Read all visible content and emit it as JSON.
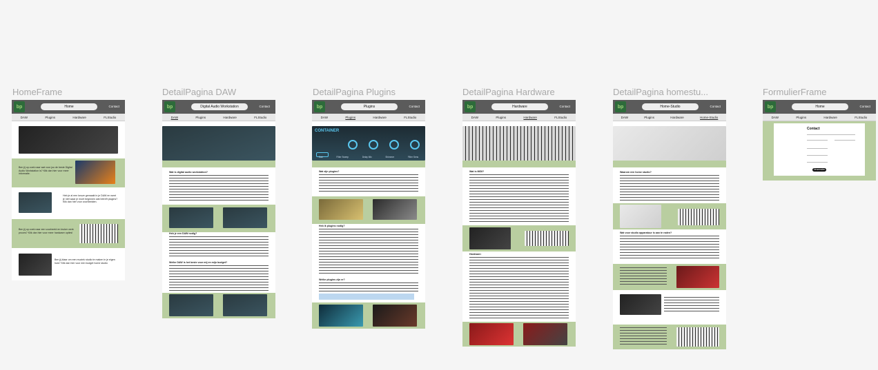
{
  "frames": [
    {
      "label": "HomeFrame",
      "pill": "Home",
      "contact": "Contact",
      "nav": [
        "DAW",
        "Plugins",
        "Hardware",
        "FLStudio"
      ],
      "texts": [
        "Ben jij op zoek naar wat voor jou de beste Digital Audio Workstation is? Klik dan hier voor meer informatie.",
        "Heb je al een keuze gemaakt in je DAW en weet je niet waar je moet beginnen wat betreft plugins? Klik dan hier voor voorbeelden.",
        "Ben jij op zoek naar een voorbeeld en leuker werk proces? Klik dan hier voor meer hardware opties!",
        "Ben jij klaar om een muziek studio te maken in je eigen huis? Klik dan hier voor een budget home studio"
      ]
    },
    {
      "label": "DetailPagina DAW",
      "pill": "Digital Audio Workstation",
      "contact": "Contact",
      "nav": [
        "DAW",
        "Plugins",
        "Hardware",
        "FLStudio"
      ],
      "h1": "Wat is digital audio workstation?",
      "h2": "Heb je een DAW nodig?",
      "h3": "Welke DAW is het beste voor mij en mijn budget?"
    },
    {
      "label": "DetailPagina Plugins",
      "pill": "Plugins",
      "contact": "Contact",
      "nav": [
        "DAW",
        "Plugins",
        "Hardware",
        "FLStudio"
      ],
      "h1": "Wat zijn plugins?",
      "h2": "Heb ik plugins nodig?",
      "h3": "Welke plugins zijn er?",
      "plugin_title": "CONTAINER",
      "knobs": [
        "Cab",
        "Filter Sweep",
        "Delay Mix",
        "Shimmer",
        "Filter Sens"
      ]
    },
    {
      "label": "DetailPagina Hardware",
      "pill": "Hardware",
      "contact": "Contact",
      "nav": [
        "DAW",
        "Plugins",
        "Hardware",
        "FLStudio"
      ],
      "h1": "Wat is MIDI?",
      "h2": "Hardware:"
    },
    {
      "label": "DetailPagina homestu...",
      "pill": "Home-Studio",
      "contact": "Contact",
      "nav": [
        "DAW",
        "Plugins",
        "Hardware",
        "Home-Studio"
      ],
      "h1": "Waarom een home studio?",
      "h2": "Wat voor studio apparatuur is aan te raden?"
    },
    {
      "label": "FormulierFrame",
      "pill": "Home",
      "contact": "Contact",
      "nav": [
        "DAW",
        "Plugins",
        "Hardware",
        "FLStudio"
      ],
      "form_title": "Contact",
      "button": "Verzenden"
    }
  ]
}
